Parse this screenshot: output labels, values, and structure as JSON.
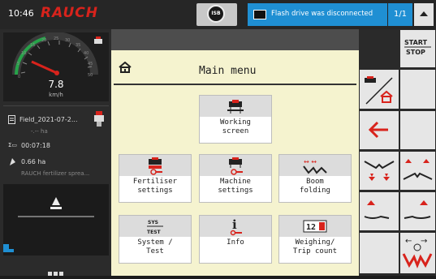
{
  "topbar": {
    "time": "10:46",
    "brand": "RAUCH",
    "isb_label": "ISB",
    "notification": "Flash drive was disconnected",
    "page_indicator": "1/1"
  },
  "left_panel": {
    "speed_value": "7.8",
    "speed_unit": "km/h",
    "gauge_ticks": [
      "0",
      "5",
      "10",
      "15",
      "20",
      "25",
      "30",
      "35",
      "40",
      "45",
      "50"
    ],
    "field_name": "Field_2021-07-2...",
    "field_area": "-.-- ha",
    "elapsed_time": "00:07:18",
    "area_value": "0.66 ha",
    "machine_name": "RAUCH fertilizer sprea..."
  },
  "main": {
    "title": "Main menu",
    "tiles": [
      {
        "id": "working-screen",
        "label": "Working\nscreen"
      },
      {
        "id": "fertiliser-settings",
        "label": "Fertiliser\nsettings"
      },
      {
        "id": "machine-settings",
        "label": "Machine\nsettings"
      },
      {
        "id": "boom-folding",
        "label": "Boom\nfolding"
      },
      {
        "id": "system-test",
        "label": "System /\nTest"
      },
      {
        "id": "info",
        "label": "Info"
      },
      {
        "id": "weighing-trip-count",
        "label": "Weighing/\nTrip count"
      }
    ],
    "sys_icon_top": "SYS",
    "sys_icon_bottom": "TEST",
    "info_icon_glyph": "i",
    "weigh_icon_glyph": "12"
  },
  "right_panel": {
    "start_label": "START",
    "stop_label": "STOP"
  },
  "colors": {
    "accent_blue": "#1f8fd3",
    "brand_red": "#d8231c",
    "panel_bg": "#f5f3cf"
  }
}
